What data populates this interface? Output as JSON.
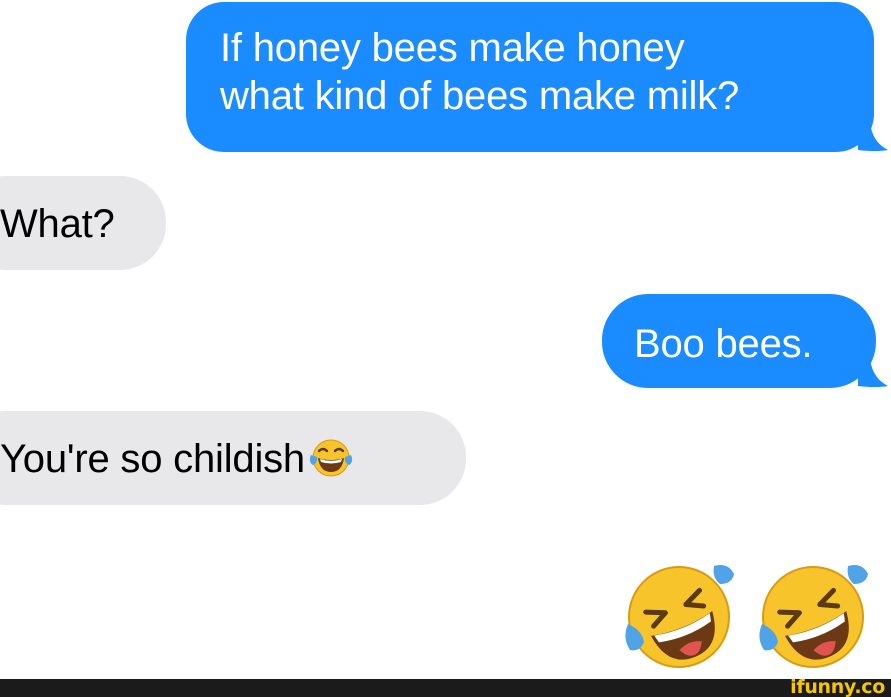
{
  "conversation": {
    "messages": [
      {
        "side": "sent",
        "lines": [
          "If honey bees make honey",
          "what kind of bees make milk?"
        ]
      },
      {
        "side": "received",
        "text": "What?"
      },
      {
        "side": "sent",
        "text": "Boo bees."
      },
      {
        "side": "received",
        "text": "You're so childish",
        "emoji": "face-with-tears-of-joy-icon"
      }
    ],
    "reaction_emojis": [
      "rolling-on-floor-laughing-icon",
      "rolling-on-floor-laughing-icon"
    ]
  },
  "colors": {
    "sent_bubble": "#1a8cff",
    "received_bubble": "#e8e8ea",
    "footer_bar": "#1b1b1b",
    "watermark": "#f6c700"
  },
  "footer": {
    "watermark": "ifunny.co"
  }
}
